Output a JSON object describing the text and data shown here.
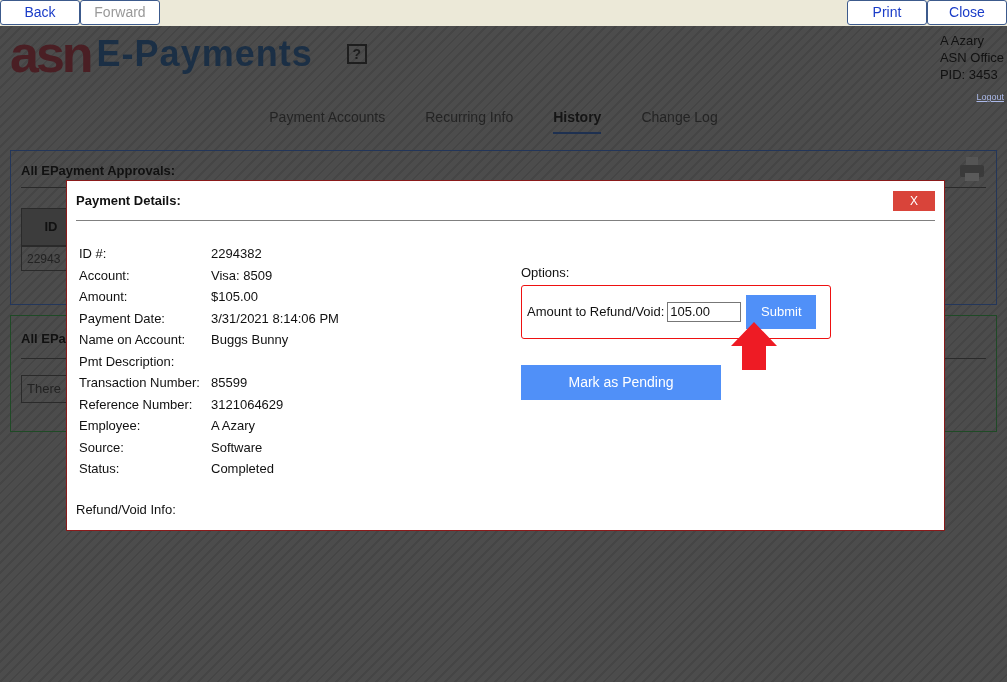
{
  "toolbar": {
    "left": [
      {
        "label": "Back",
        "disabled": false
      },
      {
        "label": "Forward",
        "disabled": true
      }
    ],
    "right": [
      {
        "label": "Print",
        "disabled": false
      },
      {
        "label": "Close",
        "disabled": false
      }
    ]
  },
  "header": {
    "logo_mark": "asn",
    "logo_text": "E-Payments",
    "help": "?",
    "user": [
      "A Azary",
      "ASN Office",
      "PID: 3453"
    ],
    "logout": "Logout"
  },
  "nav": [
    {
      "label": "Payment Accounts",
      "selected": false
    },
    {
      "label": "Recurring Info",
      "selected": false
    },
    {
      "label": "History",
      "selected": true
    },
    {
      "label": "Change Log",
      "selected": false
    }
  ],
  "approvals_panel": {
    "title": "All EPayment Approvals:",
    "column_1": "ID",
    "cell": "22943"
  },
  "second_panel": {
    "title": "All EPa",
    "message": "There"
  },
  "modal": {
    "title": "Payment Details:",
    "close": "X",
    "fields": [
      {
        "label": "ID #:",
        "value": "2294382"
      },
      {
        "label": "Account:",
        "value": "Visa: 8509"
      },
      {
        "label": "Amount:",
        "value": "$105.00"
      },
      {
        "label": "Payment Date:",
        "value": "3/31/2021 8:14:06 PM"
      },
      {
        "label": "Name on Account:",
        "value": "Buggs Bunny"
      },
      {
        "label": "Pmt Description:"
      },
      {
        "label": "Transaction Number:",
        "value": "85599"
      },
      {
        "label": "Reference Number:",
        "value": "3121064629"
      },
      {
        "label": "Employee:",
        "value": "A Azary"
      },
      {
        "label": "Source:",
        "value": "Software"
      },
      {
        "label": "Status:",
        "value": "Completed"
      }
    ],
    "refund_info": "Refund/Void Info:",
    "options_label": "Options:",
    "amount_label": "Amount to Refund/Void:",
    "amount_value": "105.00",
    "submit": "Submit",
    "pending": "Mark as Pending"
  }
}
